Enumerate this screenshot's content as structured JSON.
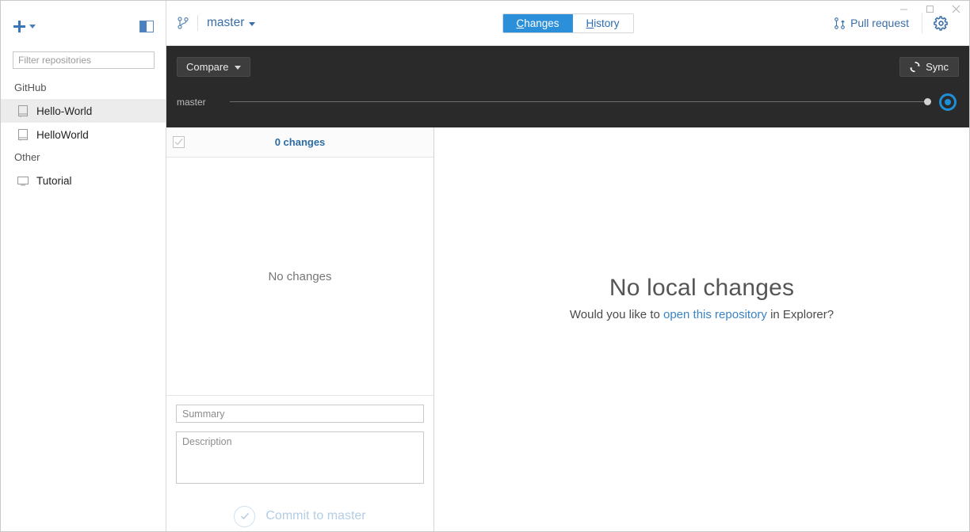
{
  "window": {
    "minimize_label": "–",
    "maximize_label": "❐",
    "close_label": "✕"
  },
  "sidebar": {
    "add_repo_icon": "plus-icon",
    "panel_toggle_icon": "sidebar-toggle-icon",
    "filter": {
      "placeholder": "Filter repositories",
      "value": ""
    },
    "groups": [
      {
        "label": "GitHub",
        "items": [
          {
            "name": "Hello-World",
            "icon": "repository-icon",
            "selected": true
          },
          {
            "name": "HelloWorld",
            "icon": "repository-icon",
            "selected": false
          }
        ]
      },
      {
        "label": "Other",
        "items": [
          {
            "name": "Tutorial",
            "icon": "monitor-icon",
            "selected": false
          }
        ]
      }
    ]
  },
  "toolbar": {
    "branch_icon": "branch-icon",
    "branch_name": "master",
    "tabs": [
      {
        "label": "Changes",
        "accel": "C",
        "active": true
      },
      {
        "label": "History",
        "accel": "H",
        "active": false
      }
    ],
    "pull_request_label": "Pull request",
    "pull_request_icon": "pull-request-icon",
    "settings_icon": "gear-icon"
  },
  "compare_bar": {
    "compare_label": "Compare",
    "sync_label": "Sync",
    "sync_icon": "sync-icon",
    "timeline_branch": "master"
  },
  "changes_panel": {
    "select_all_checked": false,
    "count_label": "0 changes",
    "empty_label": "No changes",
    "summary_placeholder": "Summary",
    "summary_value": "",
    "description_placeholder": "Description",
    "description_value": "",
    "commit_label": "Commit to master",
    "commit_icon": "check-circle-icon"
  },
  "main": {
    "title": "No local changes",
    "subtitle_before": "Would you like to ",
    "subtitle_link": "open this repository",
    "subtitle_after": " in Explorer?"
  },
  "colors": {
    "accent_blue": "#2b8fd9",
    "link_blue": "#3a83c4",
    "dark_bar": "#2a2a2a",
    "selection_grey": "#ececec"
  }
}
